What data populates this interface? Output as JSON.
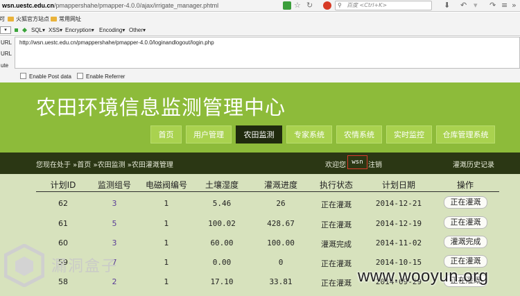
{
  "browser": {
    "url_host": "wsn.uestc.edu.cn",
    "url_path": "/pmappershahe/pmapper-4.0.0/ajax/irrigate_manager.phtml",
    "search_placeholder": "百度 <Ctrl+K>",
    "bookmarks": [
      {
        "label": "可"
      },
      {
        "label": "火狐官方站点"
      },
      {
        "label": "常用网址"
      }
    ]
  },
  "hackbar": {
    "selector": "▾",
    "menus": [
      "SQL▾",
      "XSS▾",
      "Encryption▾",
      "Encoding▾",
      "Other▾"
    ],
    "labels": [
      "URL",
      "URL",
      "ute"
    ],
    "url_value": "http://wsn.uestc.edu.cn/pmappershahe/pmapper-4.0.0/loginandlogout/login.php",
    "enable_post": "Enable Post data",
    "enable_referrer": "Enable Referrer"
  },
  "site": {
    "title": "农田环境信息监测管理中心",
    "nav": [
      {
        "label": "首页",
        "active": false
      },
      {
        "label": "用户管理",
        "active": false
      },
      {
        "label": "农田监测",
        "active": true
      },
      {
        "label": "专家系统",
        "active": false
      },
      {
        "label": "农情系统",
        "active": false
      },
      {
        "label": "实时监控",
        "active": false
      },
      {
        "label": "仓库管理系统",
        "active": false
      }
    ],
    "breadcrumb": "您现在处于 »首页 »农田监测 »农田灌溉管理",
    "welcome": "欢迎您",
    "username": "wsn",
    "logout": "注销",
    "history_link": "灌溉历史记录"
  },
  "table": {
    "headers": [
      "计划ID",
      "监测组号",
      "电磁阀编号",
      "土壤湿度",
      "灌溉进度",
      "执行状态",
      "计划日期",
      "操作"
    ],
    "rows": [
      {
        "id": "62",
        "group": "3",
        "valve": "1",
        "humidity": "5.46",
        "progress": "26",
        "status": "正在灌溉",
        "date": "2014-12-21",
        "action": "正在灌溉"
      },
      {
        "id": "61",
        "group": "5",
        "valve": "1",
        "humidity": "100.02",
        "progress": "428.67",
        "status": "正在灌溉",
        "date": "2014-12-19",
        "action": "正在灌溉"
      },
      {
        "id": "60",
        "group": "3",
        "valve": "1",
        "humidity": "60.00",
        "progress": "100.00",
        "status": "灌溉完成",
        "date": "2014-11-02",
        "action": "灌溉完成"
      },
      {
        "id": "59",
        "group": "7",
        "valve": "1",
        "humidity": "0.00",
        "progress": "0",
        "status": "正在灌溉",
        "date": "2014-10-15",
        "action": "正在灌溉"
      },
      {
        "id": "58",
        "group": "2",
        "valve": "1",
        "humidity": "17.10",
        "progress": "33.81",
        "status": "正在灌溉",
        "date": "2014-09-29",
        "action": "正在灌溉"
      }
    ]
  },
  "watermark": {
    "left_text": "漏洞盒子",
    "right_text": "www.wooyun.org"
  }
}
